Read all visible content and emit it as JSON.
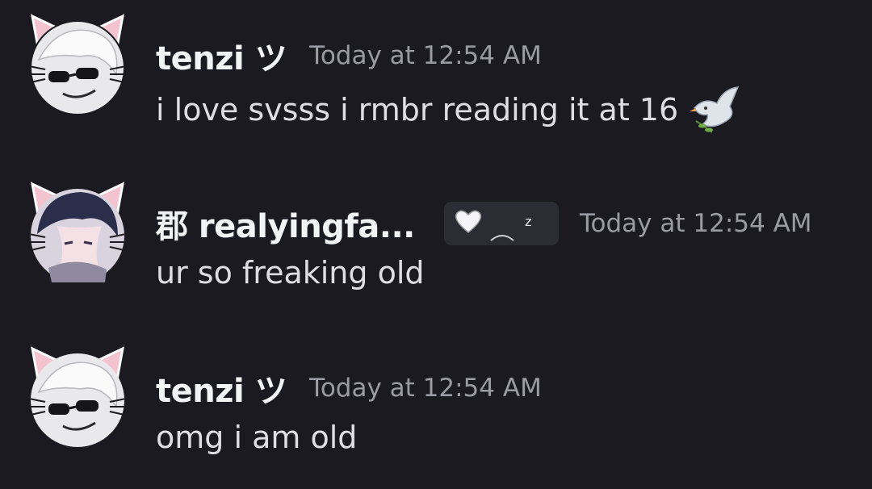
{
  "messages": [
    {
      "username": "tenzi ツ",
      "timestamp": "Today at 12:54 AM",
      "text": "i love svsss i rmbr reading it at 16",
      "emoji": "dove-icon"
    },
    {
      "username": "郡 realyingfa...",
      "timestamp": "Today at 12:54 AM",
      "text": "ur so freaking old",
      "tag_icon": "heart-sleep-icon",
      "tag_text": "zz"
    },
    {
      "username": "tenzi ツ",
      "timestamp": "Today at 12:54 AM",
      "text": "omg i am old"
    }
  ],
  "colors": {
    "background": "#1a1a20",
    "username": "#f2f3f5",
    "timestamp": "#9a9ba3",
    "message_text": "#dedee3",
    "tag_background": "#2c2d34",
    "avatar_ear_pink": "#f3c3cf"
  }
}
